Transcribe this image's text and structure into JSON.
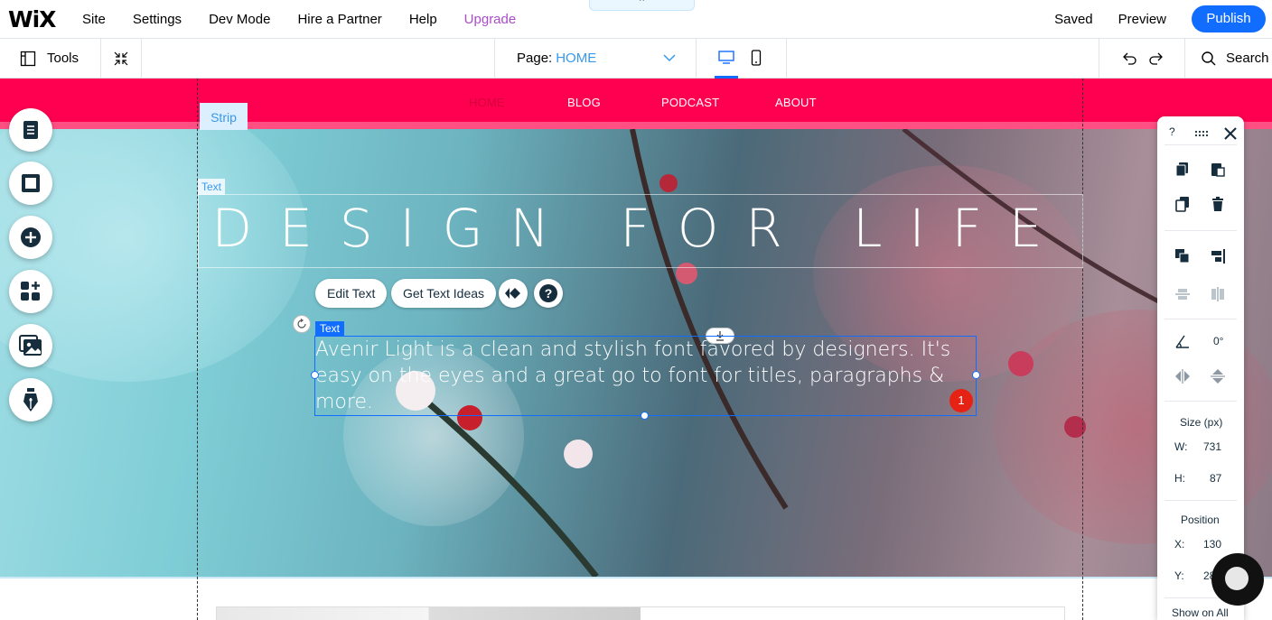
{
  "topbar": {
    "logo": "WiX",
    "menu": [
      "Site",
      "Settings",
      "Dev Mode",
      "Hire a Partner",
      "Help",
      "Upgrade"
    ],
    "collapse_glyph": "⌃",
    "saved": "Saved",
    "preview": "Preview",
    "publish": "Publish"
  },
  "subbar": {
    "tools": "Tools",
    "page_label": "Page:",
    "page_value": "HOME",
    "search": "Search"
  },
  "site": {
    "nav": [
      "HOME",
      "BLOG",
      "PODCAST",
      "ABOUT"
    ],
    "strip_tag": "Strip",
    "text_tag": "Text",
    "title": "DESIGN FOR LIFE",
    "edit_text": "Edit Text",
    "get_text_ideas": "Get Text Ideas",
    "selected_tag": "Text",
    "body": "Avenir Light is a clean and stylish font favored by designers. It's easy on the eyes and a great go to font for titles, paragraphs & more.",
    "badge": "1"
  },
  "panel": {
    "help": "?",
    "rotation": "0°",
    "size_label": "Size (px)",
    "w_label": "W:",
    "w_value": "731",
    "h_label": "H:",
    "h_value": "87",
    "position_label": "Position",
    "x_label": "X:",
    "x_value": "130",
    "y_label": "Y:",
    "y_value": "285",
    "show_on_all": "Show on All"
  },
  "colors": {
    "accent": "#116dff",
    "upgrade": "#aa4dc8",
    "nav_strip": "#ff0051",
    "badge": "#e62214"
  }
}
